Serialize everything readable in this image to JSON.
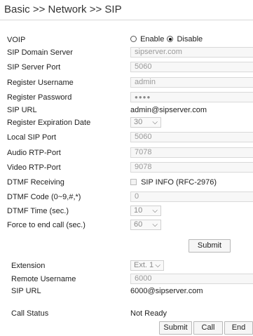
{
  "breadcrumb": "Basic >> Network >> SIP",
  "voip": {
    "label": "VOIP",
    "enable_label": "Enable",
    "disable_label": "Disable",
    "selected": "Disable"
  },
  "fields": {
    "sip_domain_server": {
      "label": "SIP Domain Server",
      "value": "sipserver.com"
    },
    "sip_server_port": {
      "label": "SIP Server Port",
      "value": "5060"
    },
    "register_username": {
      "label": "Register Username",
      "value": "admin"
    },
    "register_password": {
      "label": "Register Password",
      "value": "●●●●"
    },
    "sip_url": {
      "label": "SIP URL",
      "value": "admin@sipserver.com"
    },
    "register_expiration_date": {
      "label": "Register Expiration Date",
      "value": "30"
    },
    "local_sip_port": {
      "label": "Local SIP Port",
      "value": "5060"
    },
    "audio_rtp_port": {
      "label": "Audio RTP-Port",
      "value": "7078"
    },
    "video_rtp_port": {
      "label": "Video RTP-Port",
      "value": "9078"
    },
    "dtmf_receiving": {
      "label": "DTMF Receiving",
      "value": "SIP INFO (RFC-2976)"
    },
    "dtmf_code": {
      "label": "DTMF Code (0~9,#,*)",
      "value": "0"
    },
    "dtmf_time": {
      "label": "DTMF Time (sec.)",
      "value": "10"
    },
    "force_end_call": {
      "label": "Force to end call (sec.)",
      "value": "60"
    }
  },
  "submit_label": "Submit",
  "extension": {
    "label": "Extension",
    "value": "Ext. 1",
    "remote_username_label": "Remote Username",
    "remote_username_value": "6000",
    "sip_url_label": "SIP URL",
    "sip_url_value": "6000@sipserver.com"
  },
  "call_status": {
    "label": "Call Status",
    "value": "Not Ready"
  },
  "actions": {
    "submit": "Submit",
    "call": "Call",
    "end": "End"
  }
}
